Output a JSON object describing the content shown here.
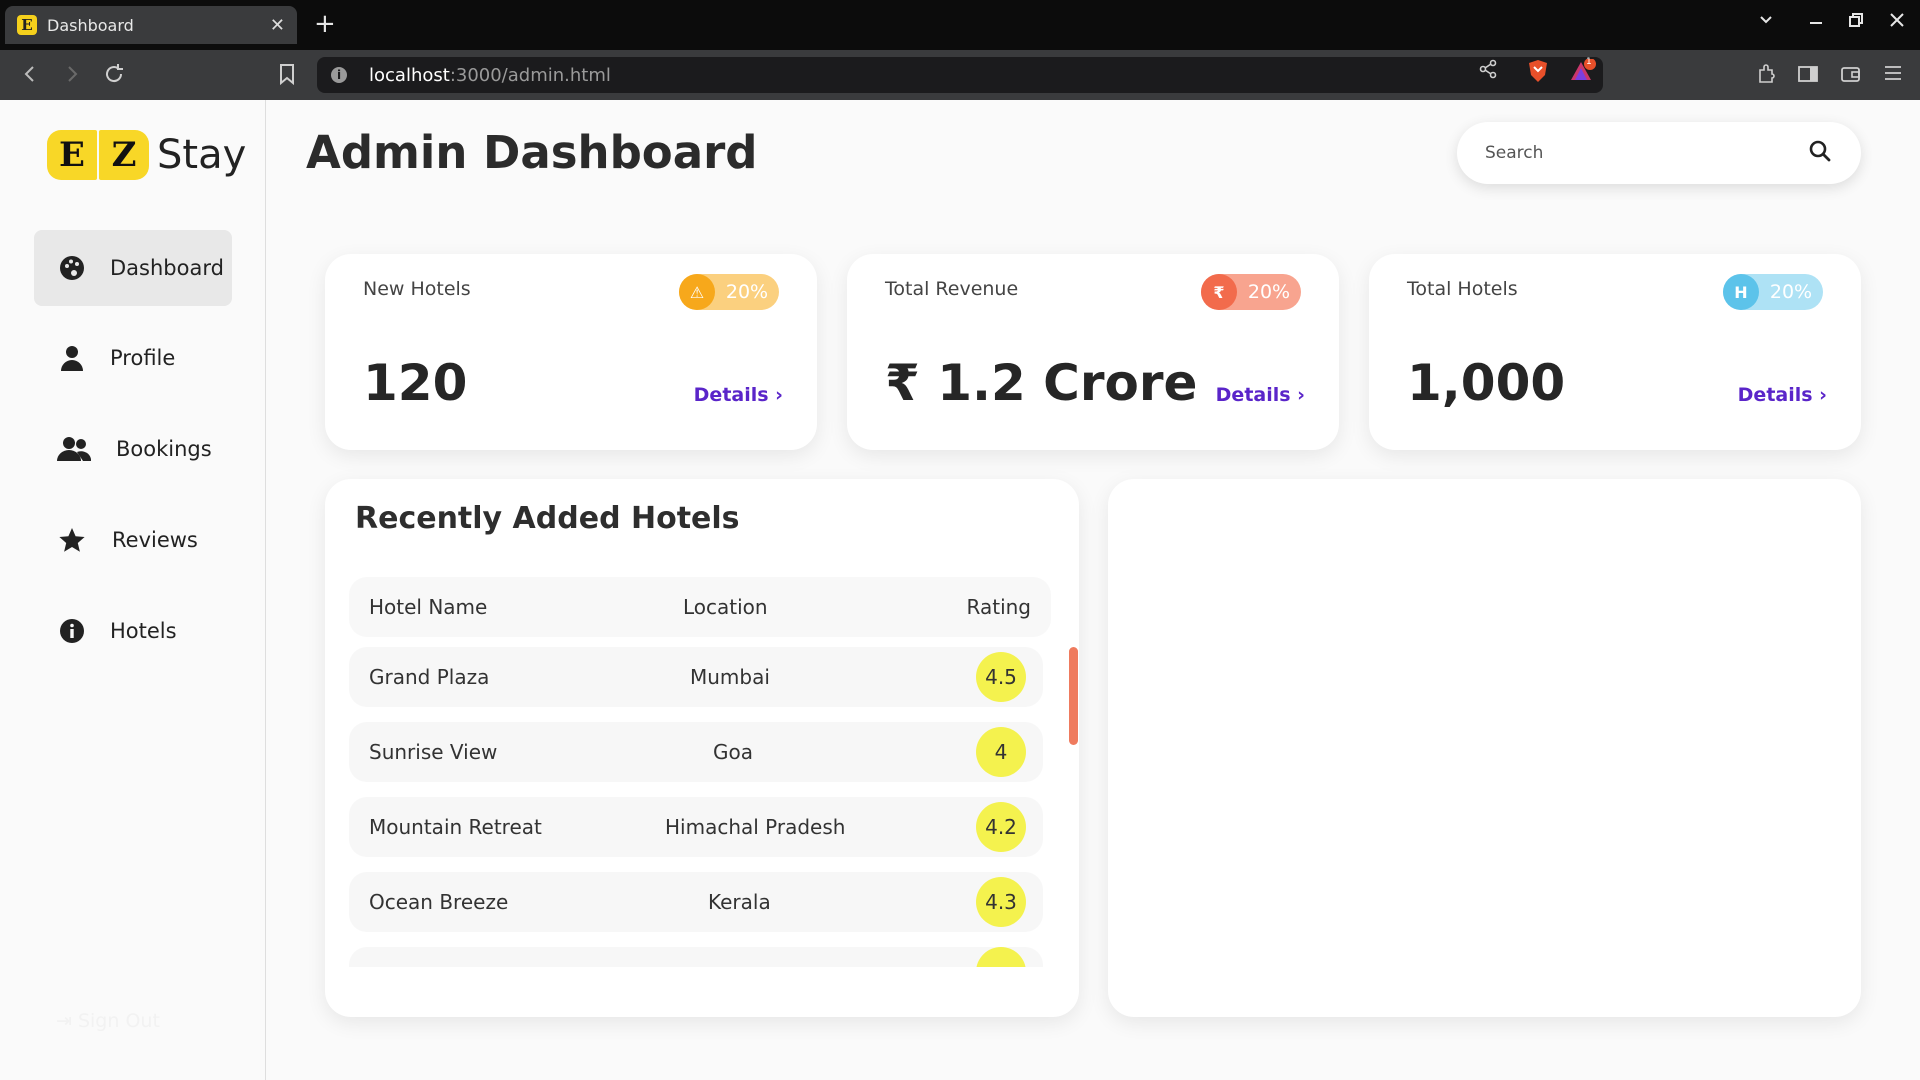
{
  "browser": {
    "tab_title": "Dashboard",
    "tab_favicon_letter": "E",
    "url_host": "localhost",
    "url_path": ":3000/admin.html",
    "brave_notification_count": "1"
  },
  "sidebar": {
    "logo": {
      "letter1": "E",
      "letter2": "Z",
      "word": "Stay"
    },
    "items": [
      {
        "label": "Dashboard",
        "icon": "palette-icon",
        "active": true
      },
      {
        "label": "Profile",
        "icon": "user-icon",
        "active": false
      },
      {
        "label": "Bookings",
        "icon": "users-icon",
        "active": false
      },
      {
        "label": "Reviews",
        "icon": "star-icon",
        "active": false
      },
      {
        "label": "Hotels",
        "icon": "info-icon",
        "active": false
      }
    ],
    "signout_label": "Sign Out"
  },
  "header": {
    "title": "Admin Dashboard",
    "search_placeholder": "Search"
  },
  "cards": [
    {
      "title": "New Hotels",
      "value": "120",
      "badge_pct": "20%",
      "badge_icon": "alert-triangle-icon",
      "badge_glyph": "⚠",
      "color": "#f7a81b",
      "link": "Details ›"
    },
    {
      "title": "Total Revenue",
      "value": "₹ 1.2 Crore",
      "badge_pct": "20%",
      "badge_icon": "rupee-icon",
      "badge_glyph": "₹",
      "color": "#f26b4c",
      "link": "Details ›"
    },
    {
      "title": "Total Hotels",
      "value": "1,000",
      "badge_pct": "20%",
      "badge_icon": "hotel-icon",
      "badge_glyph": "H",
      "color": "#5cc3ea",
      "link": "Details ›"
    }
  ],
  "recent_hotels": {
    "title": "Recently Added Hotels",
    "columns": [
      "Hotel Name",
      "Location",
      "Rating"
    ],
    "rows": [
      {
        "name": "Grand Plaza",
        "location": "Mumbai",
        "rating": "4.5"
      },
      {
        "name": "Sunrise View",
        "location": "Goa",
        "rating": "4"
      },
      {
        "name": "Mountain Retreat",
        "location": "Himachal Pradesh",
        "rating": "4.2"
      },
      {
        "name": "Ocean Breeze",
        "location": "Kerala",
        "rating": "4.3"
      }
    ]
  },
  "colors": {
    "accent_link": "#5a25c9",
    "logo_yellow": "#f8d727",
    "rating_yellow": "#f4f24e",
    "scrollbar": "#ef7b5e"
  }
}
